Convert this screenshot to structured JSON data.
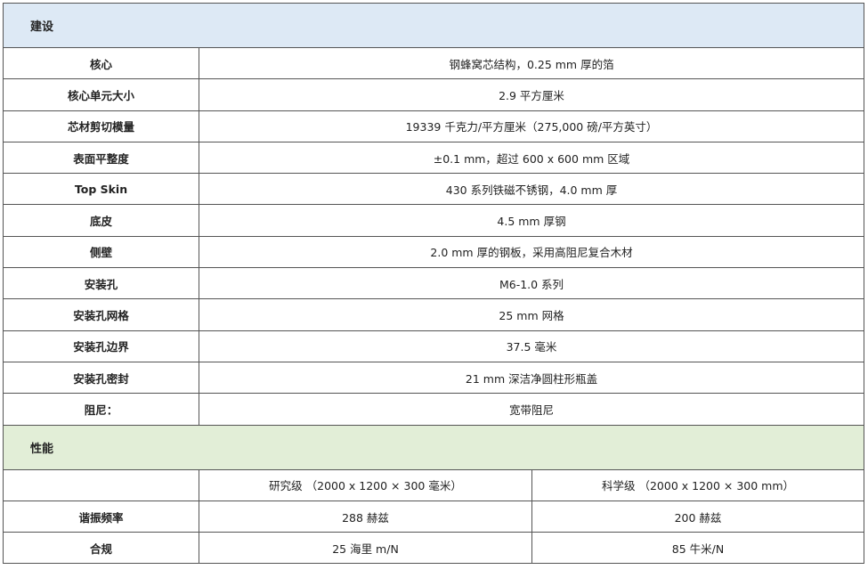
{
  "sections": {
    "construction": {
      "title": "建设",
      "rows": [
        {
          "label": "核心",
          "value": "钢蜂窝芯结构，0.25 mm 厚的箔"
        },
        {
          "label": "核心单元大小",
          "value": "2.9 平方厘米"
        },
        {
          "label": "芯材剪切模量",
          "value": "19339 千克力/平方厘米（275,000 磅/平方英寸）"
        },
        {
          "label": "表面平整度",
          "value": "±0.1 mm，超过 600 x 600 mm 区域"
        },
        {
          "label": "Top Skin",
          "value": "430 系列铁磁不锈钢，4.0 mm 厚"
        },
        {
          "label": "底皮",
          "value": "4.5 mm 厚钢"
        },
        {
          "label": "侧壁",
          "value": "2.0 mm 厚的钢板，采用高阻尼复合木材"
        },
        {
          "label": "安装孔",
          "value": "M6-1.0 系列"
        },
        {
          "label": "安装孔网格",
          "value": "25 mm 网格"
        },
        {
          "label": "安装孔边界",
          "value": "37.5 毫米"
        },
        {
          "label": "安装孔密封",
          "value": "21 mm 深洁净圆柱形瓶盖"
        },
        {
          "label": "阻尼：",
          "value": "宽带阻尼"
        }
      ]
    },
    "performance": {
      "title": "性能",
      "header": {
        "blank": "",
        "col1": "研究级 （2000 x 1200 × 300 毫米）",
        "col2": "科学级 （2000 x 1200 × 300 mm）"
      },
      "rows": [
        {
          "label": "谐振频率",
          "col1": "288 赫兹",
          "col2": "200 赫兹"
        },
        {
          "label": "合规",
          "col1": "25 海里 m/N",
          "col2": "85 牛米/N"
        }
      ]
    }
  }
}
